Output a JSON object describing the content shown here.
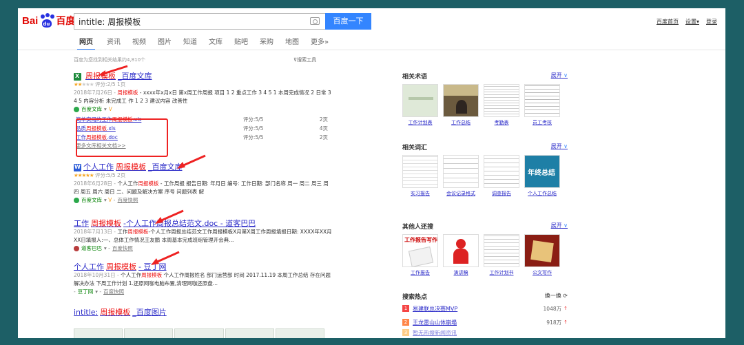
{
  "header": {
    "logo_a": "Bai",
    "logo_du": "du",
    "logo_b": "百度",
    "search_value": "intitle: 周报模板",
    "search_button": "百度一下",
    "top_links": [
      "百度首页",
      "设置▾",
      "登录"
    ]
  },
  "tabs": [
    "网页",
    "资讯",
    "视频",
    "图片",
    "知道",
    "文库",
    "贴吧",
    "采购",
    "地图",
    "更多»"
  ],
  "stats": "百度为您找到相关结果约4,810个",
  "search_tools": "搜索工具",
  "results": [
    {
      "title_pre": "",
      "title_hl": "周报模板",
      "title_post": "_百度文库",
      "rating": "评分:2/5",
      "pages": "1页",
      "snippet_date": "2018年7月26日 - ",
      "snippet_hl": "周报模板",
      "snippet_rest": " - xxxx年x月x日 第x周工作周报 项目 1 2 重点工作 3 4 5 1 本周完成情况 2 日常 3 4 5 内容分析 未完成工 作 1 2 3 建议内容 改善性",
      "source": "百度文库",
      "source_extra": "V",
      "subs": [
        {
          "name_pre": "简单实用的工作",
          "name_hl": "周报模板",
          "name_post": ".xls",
          "score": "评分:5/5",
          "pages": "2页"
        },
        {
          "name_pre": "品质",
          "name_hl": "周报模板",
          "name_post": ".xls",
          "score": "评分:5/5",
          "pages": "4页"
        },
        {
          "name_pre": "工作",
          "name_hl": "周报模板",
          "name_post": ".doc",
          "score": "评分:5/5",
          "pages": "2页"
        }
      ],
      "more": "更多文库相关文档>>"
    },
    {
      "title_pre": "个人工作",
      "title_hl": "周报模板",
      "title_post": "_百度文库",
      "rating": "评分:5/5",
      "pages": "2页",
      "snippet_date": "2018年6月28日 - ",
      "snippet_pre": "个人工作",
      "snippet_hl": "周报模板",
      "snippet_rest": " - 工作周报 报告日期: 年月日 编号: 工作日期: 部门名称 周一 周二 周三 周四 周五 周六 周日 二、问题及解决方案 序号 问题列表 解",
      "source": "百度文库",
      "snapshot": "百度快照"
    },
    {
      "title_pre": "工作",
      "title_hl": "周报模板",
      "title_post": "-个人工作周报总结范文.doc - 道客巴巴",
      "snippet_date": "2018年7月13日 - ",
      "snippet_pre": "工作",
      "snippet_hl": "周报模板",
      "snippet_rest": "-个人工作周报总结范文工作周报模板X月第X周工作周报填报日期: XXXX年XX月XX日填报人:一、总体工作情况王友鹏 本周基本完成班组管理开会典...",
      "source": "道客巴巴",
      "snapshot": "百度快照"
    },
    {
      "title_pre": "个人工作",
      "title_hl": "周报模板",
      "title_post": " - 豆丁网",
      "snippet_date": "2018年10月31日 - ",
      "snippet_pre": "个人工作",
      "snippet_hl": "周报模板",
      "snippet_rest": " 个人工作周报姓名 部门运营部 时间 2017.11.19 本周工作总结 存在问题 解决办法 下周工作计划 1.还原网咖电脑布置,清理网咖还原盘...",
      "source": "豆丁网",
      "snapshot": "百度快照"
    },
    {
      "title_pre": "intitle:",
      "title_hl": "周报模板",
      "title_post": "_百度图片"
    }
  ],
  "right": {
    "terms": {
      "header": "相关术语",
      "expand": "展开",
      "items": [
        "工作计划表",
        "工作总结",
        "考勤表",
        "员工考核"
      ]
    },
    "words": {
      "header": "相关词汇",
      "expand": "展开",
      "items": [
        "实习报告",
        "会议记录格式",
        "调查报告",
        "个人工作总结"
      ]
    },
    "others": {
      "header": "其他人还搜",
      "expand": "展开",
      "items": [
        "工作报告",
        "演讲稿",
        "工作计划书",
        "公文写作"
      ]
    },
    "hot": {
      "header": "搜索热点",
      "refresh": "换一换",
      "items": [
        {
          "rank": "1",
          "name": "易建联总决赛MVP",
          "count": "1048万",
          "color": "#f54545"
        },
        {
          "rank": "2",
          "name": "王龙雷山山体崩塌",
          "count": "918万",
          "color": "#ff8547"
        },
        {
          "rank": "3",
          "name": "暂无热搜新闻资讯",
          "count": "",
          "color": "#ffac38"
        }
      ]
    },
    "thumb_text_year": "年终总结",
    "thumb_text_report": "工作报告写作"
  },
  "colors": {
    "link": "#2b2bc8",
    "highlight": "#e11111",
    "accent": "#3385ff",
    "frame": "#1d5f66",
    "annotation": "#e22222"
  }
}
